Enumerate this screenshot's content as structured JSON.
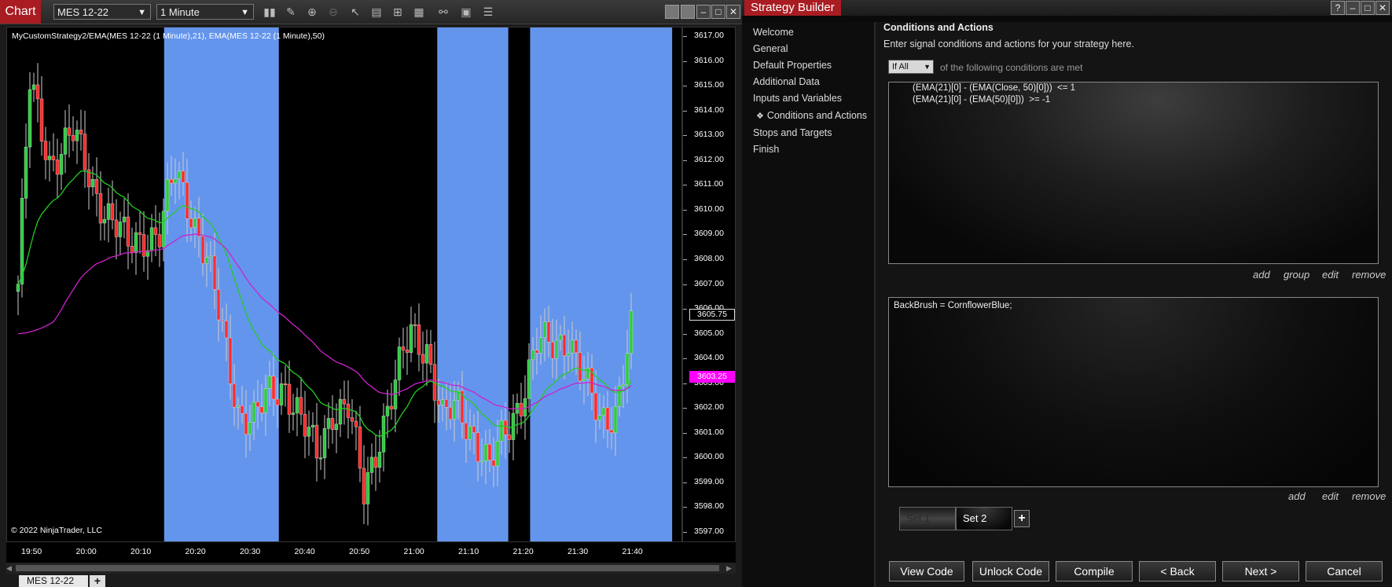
{
  "chart": {
    "tag": "Chart",
    "instrument": "MES 12-22",
    "interval": "1 Minute",
    "indicator_label": "MyCustomStrategy2/EMA(MES 12-22 (1 Minute),21), EMA(MES 12-22 (1 Minute),50)",
    "copyright": "© 2022 NinjaTrader, LLC",
    "tab_label": "MES 12-22",
    "tab_add": "+",
    "price_axis": [
      "3617.00",
      "3616.00",
      "3615.00",
      "3614.00",
      "3613.00",
      "3612.00",
      "3611.00",
      "3610.00",
      "3609.00",
      "3608.00",
      "3607.00",
      "3606.00",
      "3605.00",
      "3604.00",
      "3603.00",
      "3602.00",
      "3601.00",
      "3600.00",
      "3599.00",
      "3598.00",
      "3597.00"
    ],
    "time_axis": [
      "19:50",
      "20:00",
      "20:10",
      "20:20",
      "20:30",
      "20:40",
      "20:50",
      "21:00",
      "21:10",
      "21:20",
      "21:30",
      "21:40"
    ],
    "last_price": "3605.75",
    "ema_price": "3603.25",
    "colors": {
      "up": "#2ecc40",
      "down": "#ff2b2b",
      "ema21": "#22cc22",
      "ema50": "#cc22cc",
      "highlight": "#6495ed",
      "ema_badge": "#ff00ff"
    },
    "toolbar_icons": [
      "bar-type-icon",
      "draw-tool-icon",
      "zoom-in-icon",
      "zoom-out-icon",
      "pointer-icon",
      "data-box-icon",
      "chart-trader-icon",
      "indicators-icon",
      "strategies-icon",
      "templates-icon",
      "properties-icon"
    ]
  },
  "chart_data": {
    "type": "candlestick",
    "title": "MyCustomStrategy2/EMA(MES 12-22 (1 Minute),21), EMA(MES 12-22 (1 Minute),50)",
    "ylim": [
      3597.0,
      3617.0
    ],
    "highlight_ranges_time": [
      [
        "20:14",
        "20:35"
      ],
      [
        "21:04",
        "21:17"
      ],
      [
        "21:21",
        "21:47"
      ]
    ]
  },
  "builder": {
    "tag": "Strategy Builder",
    "help": "?",
    "nav": [
      "Welcome",
      "General",
      "Default Properties",
      "Additional Data",
      "Inputs and Variables",
      "Conditions and Actions",
      "Stops and Targets",
      "Finish"
    ],
    "nav_active_marker": "❖",
    "section_title": "Conditions and Actions",
    "section_desc": "Enter signal conditions and actions for your strategy here.",
    "if_select": "If All",
    "if_suffix": "of the following conditions are met",
    "conditions": [
      "(EMA(21)[0] - (EMA(Close, 50)[0]))  <= 1",
      "(EMA(21)[0] - (EMA(50)[0]))  >= -1"
    ],
    "cond_links": {
      "add": "add",
      "group": "group",
      "edit": "edit",
      "remove": "remove"
    },
    "actions": [
      "BackBrush = CornflowerBlue;"
    ],
    "act_links": {
      "add": "add",
      "edit": "edit",
      "remove": "remove"
    },
    "sets": [
      "Set 1",
      "Set 2"
    ],
    "set_add": "+",
    "buttons": {
      "view_code": "View Code",
      "unlock_code": "Unlock Code",
      "compile": "Compile",
      "back": "< Back",
      "next": "Next >",
      "cancel": "Cancel"
    }
  }
}
